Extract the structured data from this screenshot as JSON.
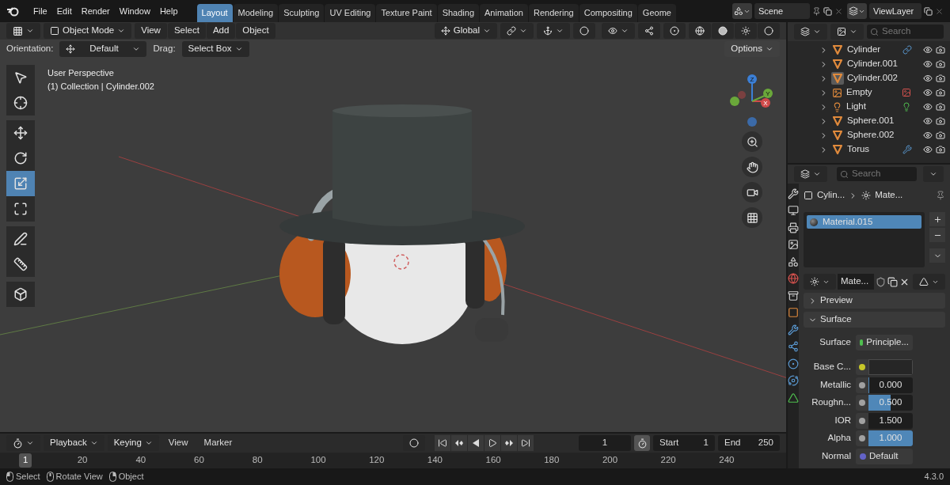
{
  "top_bar": {
    "menus": [
      "File",
      "Edit",
      "Render",
      "Window",
      "Help"
    ],
    "workspaces": [
      {
        "label": "Layout",
        "selected": true
      },
      {
        "label": "Modeling",
        "selected": false
      },
      {
        "label": "Sculpting",
        "selected": false
      },
      {
        "label": "UV Editing",
        "selected": false
      },
      {
        "label": "Texture Paint",
        "selected": false
      },
      {
        "label": "Shading",
        "selected": false
      },
      {
        "label": "Animation",
        "selected": false
      },
      {
        "label": "Rendering",
        "selected": false
      },
      {
        "label": "Compositing",
        "selected": false
      },
      {
        "label": "Geome",
        "selected": false
      }
    ],
    "scene": "Scene",
    "view_layer": "ViewLayer"
  },
  "viewport": {
    "header": {
      "mode": "Object Mode",
      "menus": [
        "View",
        "Select",
        "Add",
        "Object"
      ],
      "orientation": "Global"
    },
    "tool_settings": {
      "orientation_label": "Orientation:",
      "orientation": "Default",
      "drag_label": "Drag:",
      "drag": "Select Box",
      "options": "Options"
    },
    "toolbar": [
      {
        "kind": "select",
        "selected": false
      },
      {
        "kind": "cursor",
        "selected": false
      },
      {
        "kind": "move",
        "selected": false
      },
      {
        "kind": "rotate",
        "selected": false
      },
      {
        "kind": "scale",
        "selected": true
      },
      {
        "kind": "transform",
        "selected": false
      },
      {
        "kind": "annotate",
        "selected": false
      },
      {
        "kind": "measure",
        "selected": false
      },
      {
        "kind": "add",
        "selected": false
      }
    ],
    "overlay_text": [
      "User Perspective",
      "(1) Collection | Cylinder.002"
    ],
    "gizmo": {
      "x": "X",
      "y": "Y",
      "z": "Z"
    }
  },
  "outliner": {
    "search_placeholder": "Search",
    "items": [
      {
        "name": "Cylinder",
        "kind": "mesh",
        "active": false,
        "extra": {
          "kind": "hook"
        }
      },
      {
        "name": "Cylinder.001",
        "kind": "mesh",
        "active": false
      },
      {
        "name": "Cylinder.002",
        "kind": "mesh",
        "active": true
      },
      {
        "name": "Empty",
        "kind": "empty",
        "active": false,
        "extra": {
          "kind": "image"
        }
      },
      {
        "name": "Light",
        "kind": "light",
        "active": false,
        "extra": {
          "kind": "light"
        }
      },
      {
        "name": "Sphere.001",
        "kind": "mesh",
        "active": false
      },
      {
        "name": "Sphere.002",
        "kind": "mesh",
        "active": false
      },
      {
        "name": "Torus",
        "kind": "mesh",
        "active": false,
        "extra": {
          "kind": "modifier"
        }
      }
    ]
  },
  "properties": {
    "search_placeholder": "Search",
    "tabs": [
      {
        "kind": "tool",
        "selected": false
      },
      {
        "kind": "render",
        "selected": false
      },
      {
        "kind": "output",
        "selected": false
      },
      {
        "kind": "view_layer",
        "selected": false
      },
      {
        "kind": "scene",
        "selected": false
      },
      {
        "kind": "world",
        "selected": false
      },
      {
        "kind": "collection",
        "selected": false
      },
      {
        "kind": "object",
        "selected": false
      },
      {
        "kind": "modifiers",
        "selected": false
      },
      {
        "kind": "particles",
        "selected": false
      },
      {
        "kind": "physics",
        "selected": false
      },
      {
        "kind": "constraints",
        "selected": false
      },
      {
        "kind": "data",
        "selected": false
      }
    ],
    "breadcrumb": [
      "Cylin...",
      "Mate..."
    ],
    "material_slots": [
      {
        "name": "Material.015",
        "selected": true
      }
    ],
    "datablock": "Mate...",
    "panels": [
      {
        "title": "Preview",
        "expanded": false
      },
      {
        "title": "Surface",
        "expanded": true
      }
    ],
    "surface": {
      "label": "Surface",
      "value": "Principle...",
      "color": "#4fbf4f"
    },
    "fields": [
      {
        "label": "Base C...",
        "kind": "color",
        "color": "#c7c729"
      },
      {
        "label": "Metallic",
        "kind": "slider",
        "value": "0.000",
        "level": 0,
        "color": "#a1a1a1"
      },
      {
        "label": "Roughn...",
        "kind": "slider",
        "value": "0.500",
        "level": 0.5,
        "color": "#a1a1a1"
      },
      {
        "label": "IOR",
        "kind": "number",
        "value": "1.500",
        "color": "#a1a1a1"
      },
      {
        "label": "Alpha",
        "kind": "slider",
        "value": "1.000",
        "level": 1,
        "color": "#a1a1a1"
      },
      {
        "label": "Normal",
        "kind": "link",
        "value": "Default",
        "color": "#6363c7"
      }
    ]
  },
  "timeline": {
    "menus": [
      "Playback",
      "Keying"
    ],
    "items": [
      "View",
      "Marker"
    ],
    "current_frame": "1",
    "start_label": "Start",
    "start": "1",
    "end_label": "End",
    "end": "250",
    "ruler": [
      {
        "label": "1",
        "selected": true
      },
      {
        "label": "20",
        "selected": false
      },
      {
        "label": "40",
        "selected": false
      },
      {
        "label": "60",
        "selected": false
      },
      {
        "label": "80",
        "selected": false
      },
      {
        "label": "100",
        "selected": false
      },
      {
        "label": "120",
        "selected": false
      },
      {
        "label": "140",
        "selected": false
      },
      {
        "label": "160",
        "selected": false
      },
      {
        "label": "180",
        "selected": false
      },
      {
        "label": "200",
        "selected": false
      },
      {
        "label": "220",
        "selected": false
      },
      {
        "label": "240",
        "selected": false
      }
    ]
  },
  "status_bar": {
    "hints": [
      {
        "label": "Select",
        "kind": "left"
      },
      {
        "label": "Rotate View",
        "kind": "middle"
      },
      {
        "label": "Object",
        "kind": "right"
      }
    ],
    "version": "4.3.0"
  }
}
